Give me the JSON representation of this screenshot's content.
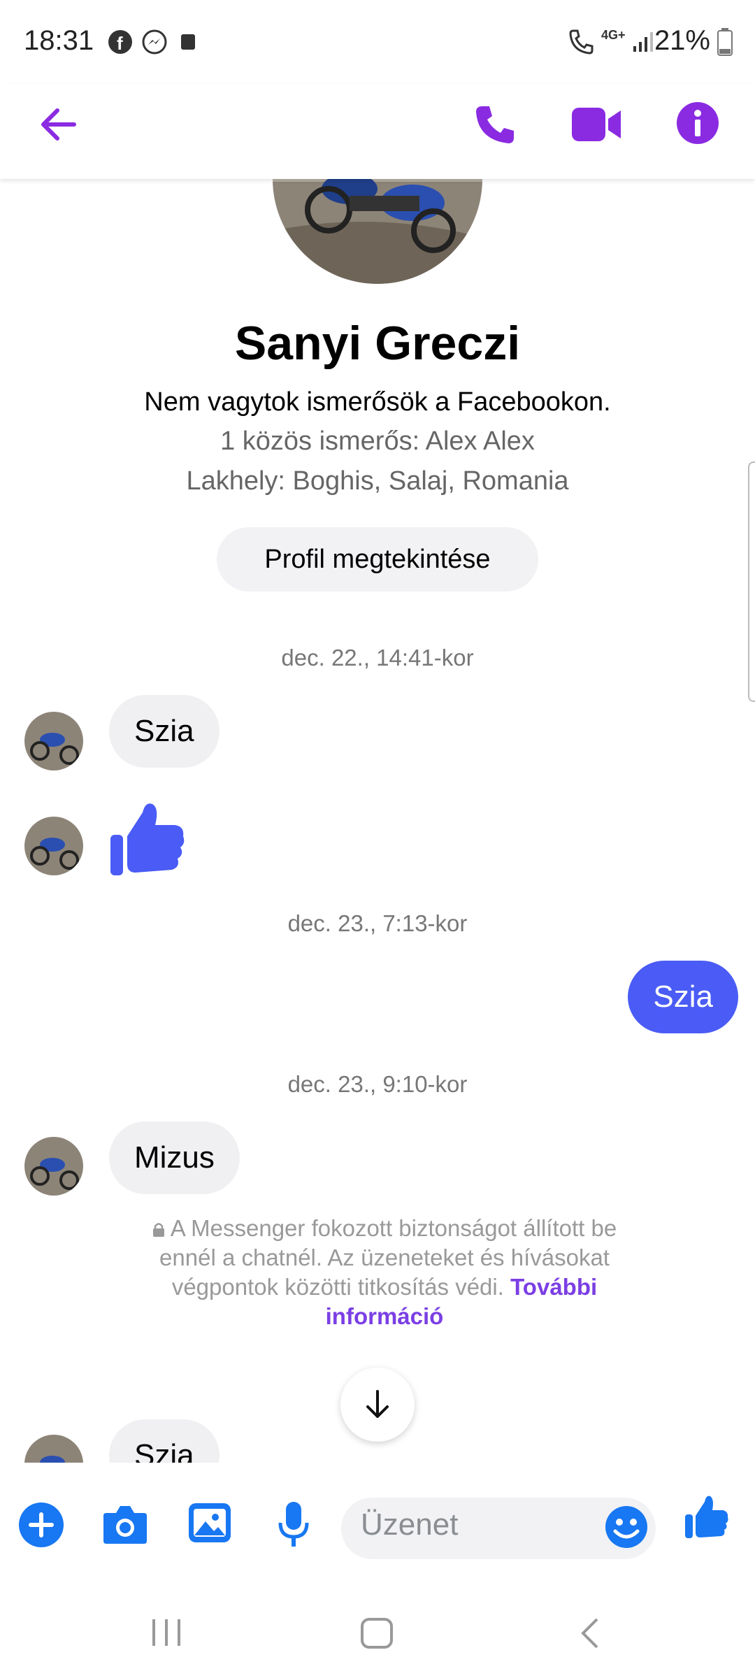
{
  "status_bar": {
    "time": "18:31",
    "battery": "21%"
  },
  "header": {
    "icons": [
      "back-arrow-icon",
      "phone-icon",
      "video-icon",
      "info-icon"
    ]
  },
  "profile": {
    "name": "Sanyi Greczi",
    "friend_status": "Nem vagytok ismerősök a Facebookon.",
    "mutual": "1 közös ismerős: Alex Alex",
    "location": "Lakhely: Boghis, Salaj, Romania",
    "view_profile": "Profil megtekintése"
  },
  "messages": {
    "stamp1": "dec. 22., 14:41-kor",
    "msg1": "Szia",
    "stamp2": "dec. 23., 7:13-kor",
    "msg_out": "Szia",
    "stamp3": "dec. 23., 9:10-kor",
    "msg3": "Mizus",
    "msg4": "Szia"
  },
  "notice": {
    "text": "A Messenger fokozott biztonságot állított be ennél a chatnél. Az üzeneteket és hívásokat végpontok közötti titkosítás védi.",
    "link": "További információ"
  },
  "composer": {
    "placeholder": "Üzenet",
    "icons": [
      "plus-icon",
      "camera-icon",
      "gallery-icon",
      "mic-icon",
      "emoji-icon",
      "like-icon"
    ]
  },
  "colors": {
    "accent": "#7b3fe4",
    "outgoing": "#4a5cf5",
    "composer": "#1877f2"
  }
}
